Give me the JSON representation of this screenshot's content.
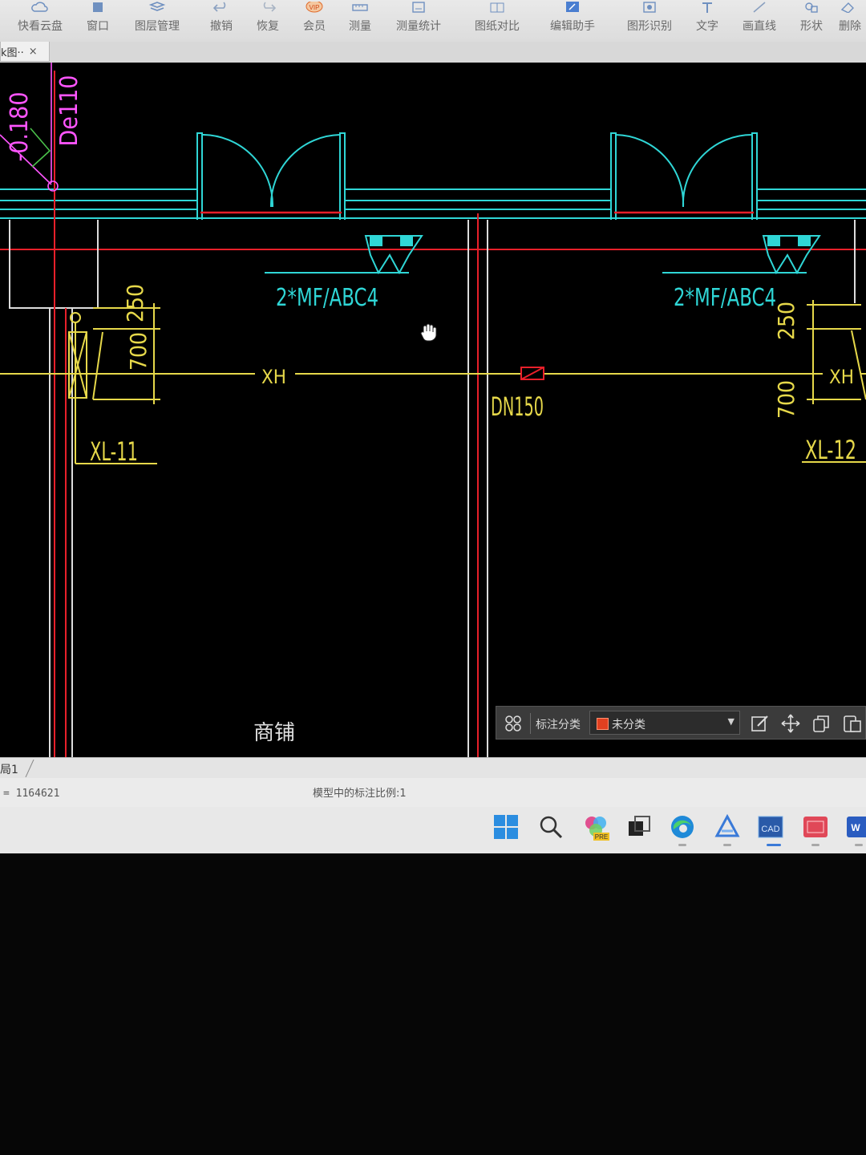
{
  "toolbar": {
    "items": [
      {
        "label": "快看云盘",
        "icon": "cloud-disk-icon"
      },
      {
        "label": "窗口",
        "icon": "window-icon"
      },
      {
        "label": "图层管理",
        "icon": "layers-icon"
      },
      {
        "label": "撤销",
        "icon": "undo-icon"
      },
      {
        "label": "恢复",
        "icon": "redo-icon"
      },
      {
        "label": "会员",
        "icon": "vip-icon",
        "badge": "VIP"
      },
      {
        "label": "测量",
        "icon": "ruler-icon"
      },
      {
        "label": "测量统计",
        "icon": "measure-stats-icon"
      },
      {
        "label": "图纸对比",
        "icon": "compare-icon"
      },
      {
        "label": "编辑助手",
        "icon": "edit-assistant-icon"
      },
      {
        "label": "图形识别",
        "icon": "shape-recognize-icon"
      },
      {
        "label": "文字",
        "icon": "text-icon"
      },
      {
        "label": "画直线",
        "icon": "line-icon"
      },
      {
        "label": "形状",
        "icon": "shape-icon"
      },
      {
        "label": "删除",
        "icon": "delete-icon"
      }
    ]
  },
  "document_tab": {
    "label": "k图··",
    "close": "×"
  },
  "drawing": {
    "labels": {
      "elevation": "-0.180",
      "pipe_size": "De110",
      "extinguisher_left": "2*MF/ABC4",
      "extinguisher_right": "2*MF/ABC4",
      "dim_250_left": "250",
      "dim_700_left": "700",
      "xh_left": "XH",
      "xh_right": "XH",
      "dn150": "DN150",
      "riser_left": "XL-11",
      "riser_right": "XL-12",
      "dim_250_right": "250",
      "dim_700_right": "700",
      "room": "商铺"
    },
    "colors": {
      "cyan": "#2fd6d6",
      "red": "#e8202a",
      "yellow": "#e6d84a",
      "white": "#dcdcdc",
      "magenta": "#ff55ff",
      "green": "#4ac04a"
    }
  },
  "dim_bar": {
    "category_label": "标注分类",
    "selected": "未分类",
    "actions": [
      "edit-icon",
      "move-icon",
      "copy-icon",
      "paste-icon"
    ]
  },
  "layout_tab": {
    "label": "局1"
  },
  "statusbar": {
    "coord": "= 1164621",
    "scale": "模型中的标注比例:1"
  },
  "taskbar": {
    "apps": [
      "windows-start-icon",
      "search-icon",
      "copilot-icon",
      "task-view-icon",
      "edge-icon",
      "ai-app-icon",
      "cad-viewer-icon",
      "cad-app-icon",
      "word-icon"
    ],
    "cad_label": "CAD",
    "word_label": "W",
    "pre_label": "PRE"
  }
}
